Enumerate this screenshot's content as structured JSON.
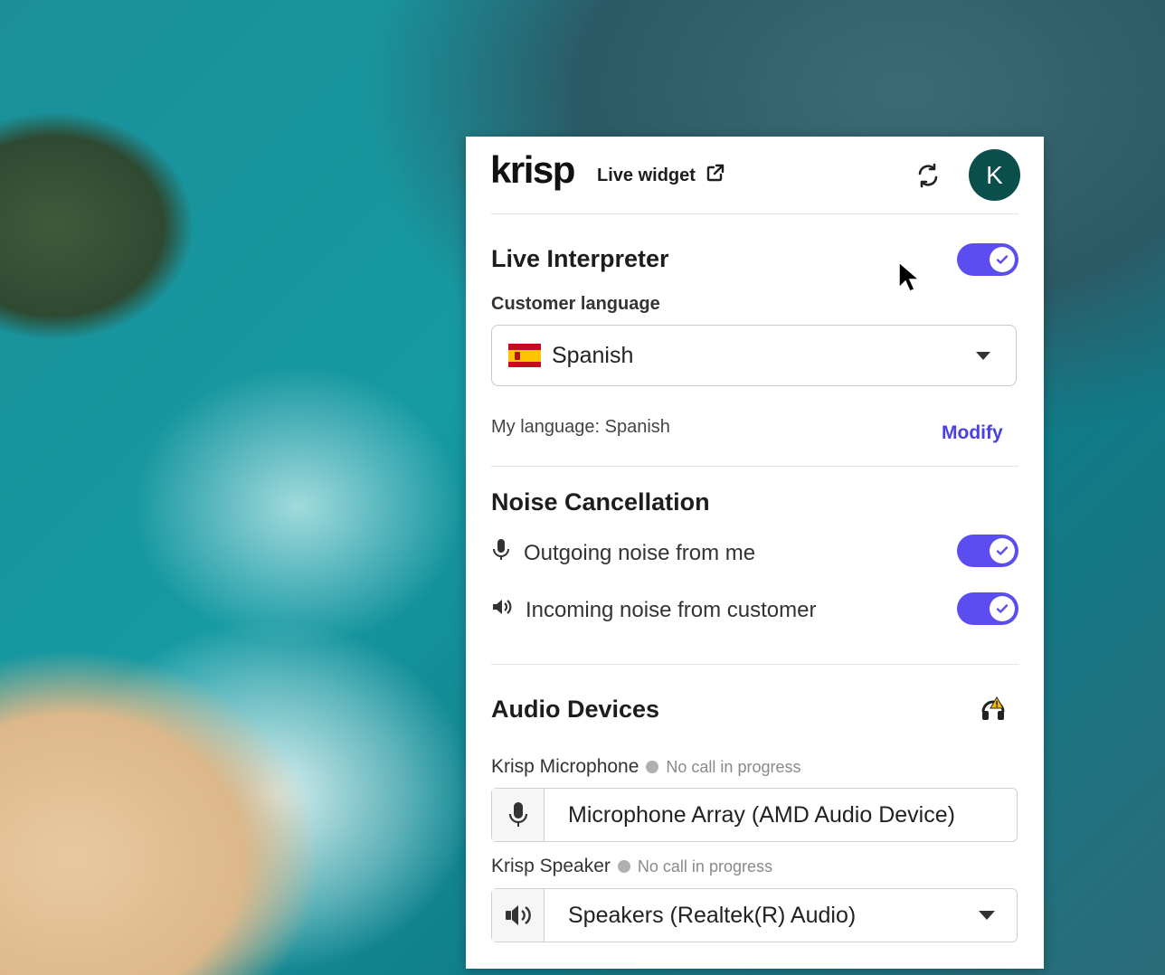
{
  "header": {
    "logo": "krisp",
    "live_widget_label": "Live widget",
    "avatar_initial": "K"
  },
  "live_interpreter": {
    "title": "Live Interpreter",
    "enabled": true,
    "customer_language_label": "Customer language",
    "customer_language_value": "Spanish",
    "my_language_text": "My language: Spanish",
    "modify_label": "Modify"
  },
  "noise_cancellation": {
    "title": "Noise Cancellation",
    "outgoing_label": "Outgoing noise from me",
    "outgoing_enabled": true,
    "incoming_label": "Incoming noise from customer",
    "incoming_enabled": true
  },
  "audio_devices": {
    "title": "Audio Devices",
    "microphone": {
      "label": "Krisp Microphone",
      "status": "No call in progress",
      "value": "Microphone Array (AMD Audio Device)"
    },
    "speaker": {
      "label": "Krisp Speaker",
      "status": "No call in progress",
      "value": "Speakers (Realtek(R) Audio)"
    }
  },
  "colors": {
    "accent": "#5b4df0",
    "link": "#4b3fe0",
    "avatar_bg": "#0b4f4c"
  },
  "icons": [
    "external-link-icon",
    "refresh-icon",
    "check-icon",
    "spain-flag-icon",
    "chevron-down-icon",
    "microphone-icon",
    "speaker-icon",
    "headset-warning-icon",
    "mouse-cursor-icon"
  ]
}
